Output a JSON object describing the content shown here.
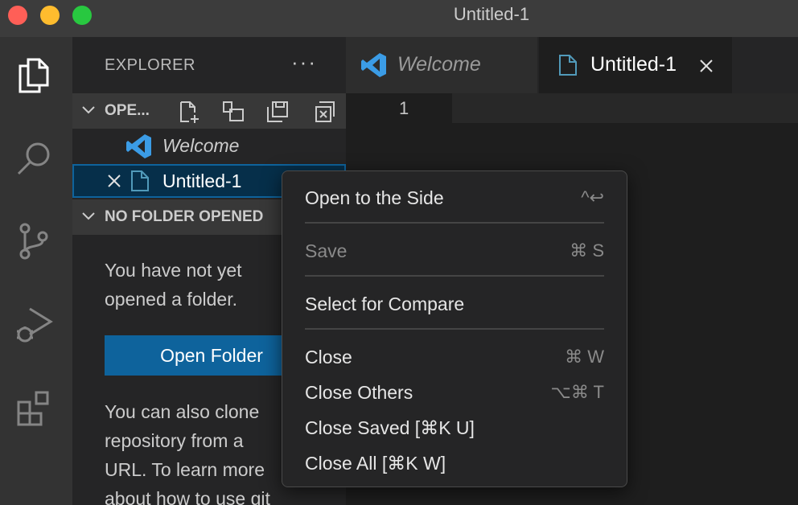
{
  "window": {
    "title": "Untitled-1"
  },
  "activity_bar": {
    "items": [
      {
        "name": "explorer",
        "icon": "files-icon"
      },
      {
        "name": "search",
        "icon": "search-icon"
      },
      {
        "name": "source-control",
        "icon": "source-control-icon"
      },
      {
        "name": "run-debug",
        "icon": "run-debug-icon"
      },
      {
        "name": "extensions",
        "icon": "extensions-icon"
      }
    ]
  },
  "sidebar": {
    "header": "EXPLORER",
    "more": "···",
    "open_editors": {
      "title": "OPE...",
      "files": [
        {
          "label": "Welcome",
          "icon": "vscode-logo-icon"
        },
        {
          "label": "Untitled-1",
          "icon": "file-icon"
        }
      ]
    },
    "no_folder": {
      "title": "NO FOLDER OPENED",
      "text_line1": "You have not yet",
      "text_line2": "opened a folder.",
      "open_folder_button": "Open Folder",
      "clone_line1": "You can also clone",
      "clone_line2": "repository from a",
      "clone_line3": "URL. To learn more",
      "clone_line4": "about how to use git"
    }
  },
  "editor": {
    "tabs": [
      {
        "label": "Welcome",
        "active": false
      },
      {
        "label": "Untitled-1",
        "active": true
      }
    ],
    "line_number": "1"
  },
  "context_menu": {
    "items": [
      {
        "label": "Open to the Side",
        "shortcut": "^↩",
        "enabled": true
      },
      {
        "label": "Save",
        "shortcut": "⌘ S",
        "enabled": false
      },
      {
        "label": "Select for Compare",
        "shortcut": "",
        "enabled": true
      },
      {
        "label": "Close",
        "shortcut": "⌘ W",
        "enabled": true
      },
      {
        "label": "Close Others",
        "shortcut": "⌥⌘ T",
        "enabled": true
      },
      {
        "label": "Close Saved [⌘K U]",
        "shortcut": "",
        "enabled": true
      },
      {
        "label": "Close All [⌘K W]",
        "shortcut": "",
        "enabled": true
      }
    ]
  },
  "colors": {
    "accent": "#0e639c",
    "vscode_blue": "#3b9ce6",
    "file_icon": "#519aba"
  }
}
